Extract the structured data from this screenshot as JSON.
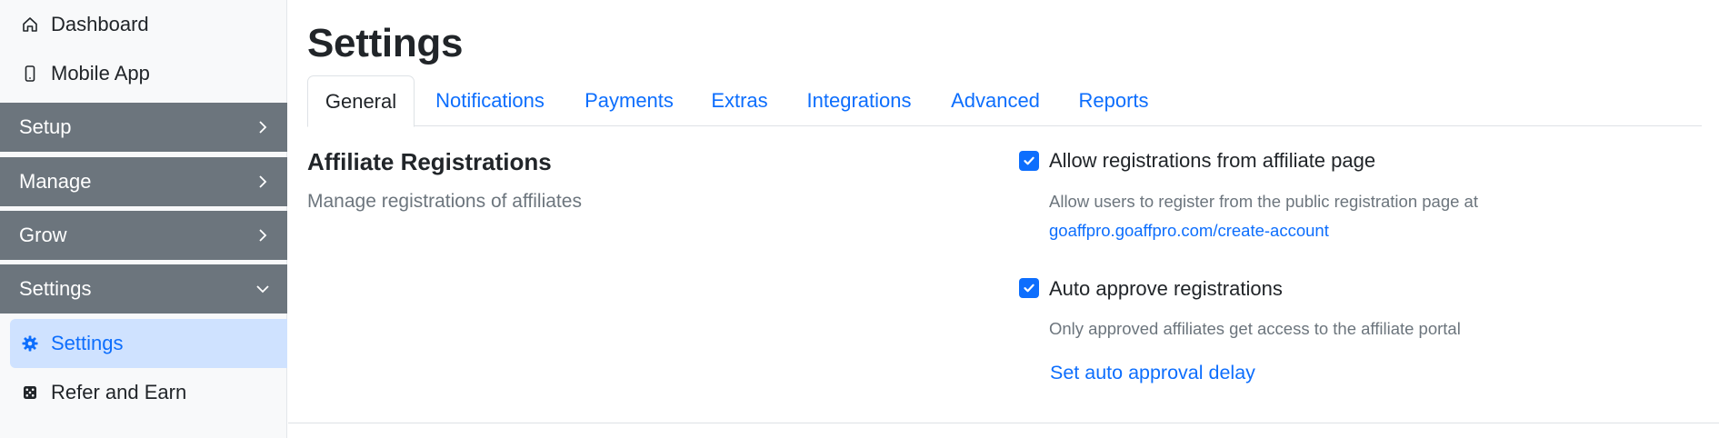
{
  "sidebar": {
    "top_items": [
      {
        "label": "Dashboard",
        "icon": "home-icon"
      },
      {
        "label": "Mobile App",
        "icon": "mobile-icon"
      }
    ],
    "sections": [
      {
        "label": "Setup",
        "state": "collapsed"
      },
      {
        "label": "Manage",
        "state": "collapsed"
      },
      {
        "label": "Grow",
        "state": "collapsed"
      },
      {
        "label": "Settings",
        "state": "expanded"
      }
    ],
    "sub_items": [
      {
        "label": "Settings",
        "icon": "gear-icon",
        "active": true
      },
      {
        "label": "Refer and Earn",
        "icon": "dice-icon",
        "active": false
      }
    ]
  },
  "page": {
    "title": "Settings",
    "tabs": [
      {
        "label": "General",
        "active": true
      },
      {
        "label": "Notifications",
        "active": false
      },
      {
        "label": "Payments",
        "active": false
      },
      {
        "label": "Extras",
        "active": false
      },
      {
        "label": "Integrations",
        "active": false
      },
      {
        "label": "Advanced",
        "active": false
      },
      {
        "label": "Reports",
        "active": false
      }
    ]
  },
  "affiliate_registrations": {
    "title": "Affiliate Registrations",
    "subtitle": "Manage registrations of affiliates",
    "options": [
      {
        "label": "Allow registrations from affiliate page",
        "checked": true,
        "help": "Allow users to register from the public registration page at",
        "link": "goaffpro.goaffpro.com/create-account"
      },
      {
        "label": "Auto approve registrations",
        "checked": true,
        "help": "Only approved affiliates get access to the affiliate portal",
        "link": "Set auto approval delay"
      }
    ]
  },
  "colors": {
    "primary": "#0d6efd",
    "sidebar_section_bg": "#6c757d",
    "active_item_bg": "#cfe2ff",
    "muted_text": "#6c757d",
    "sidebar_bg": "#f8f9fa"
  }
}
